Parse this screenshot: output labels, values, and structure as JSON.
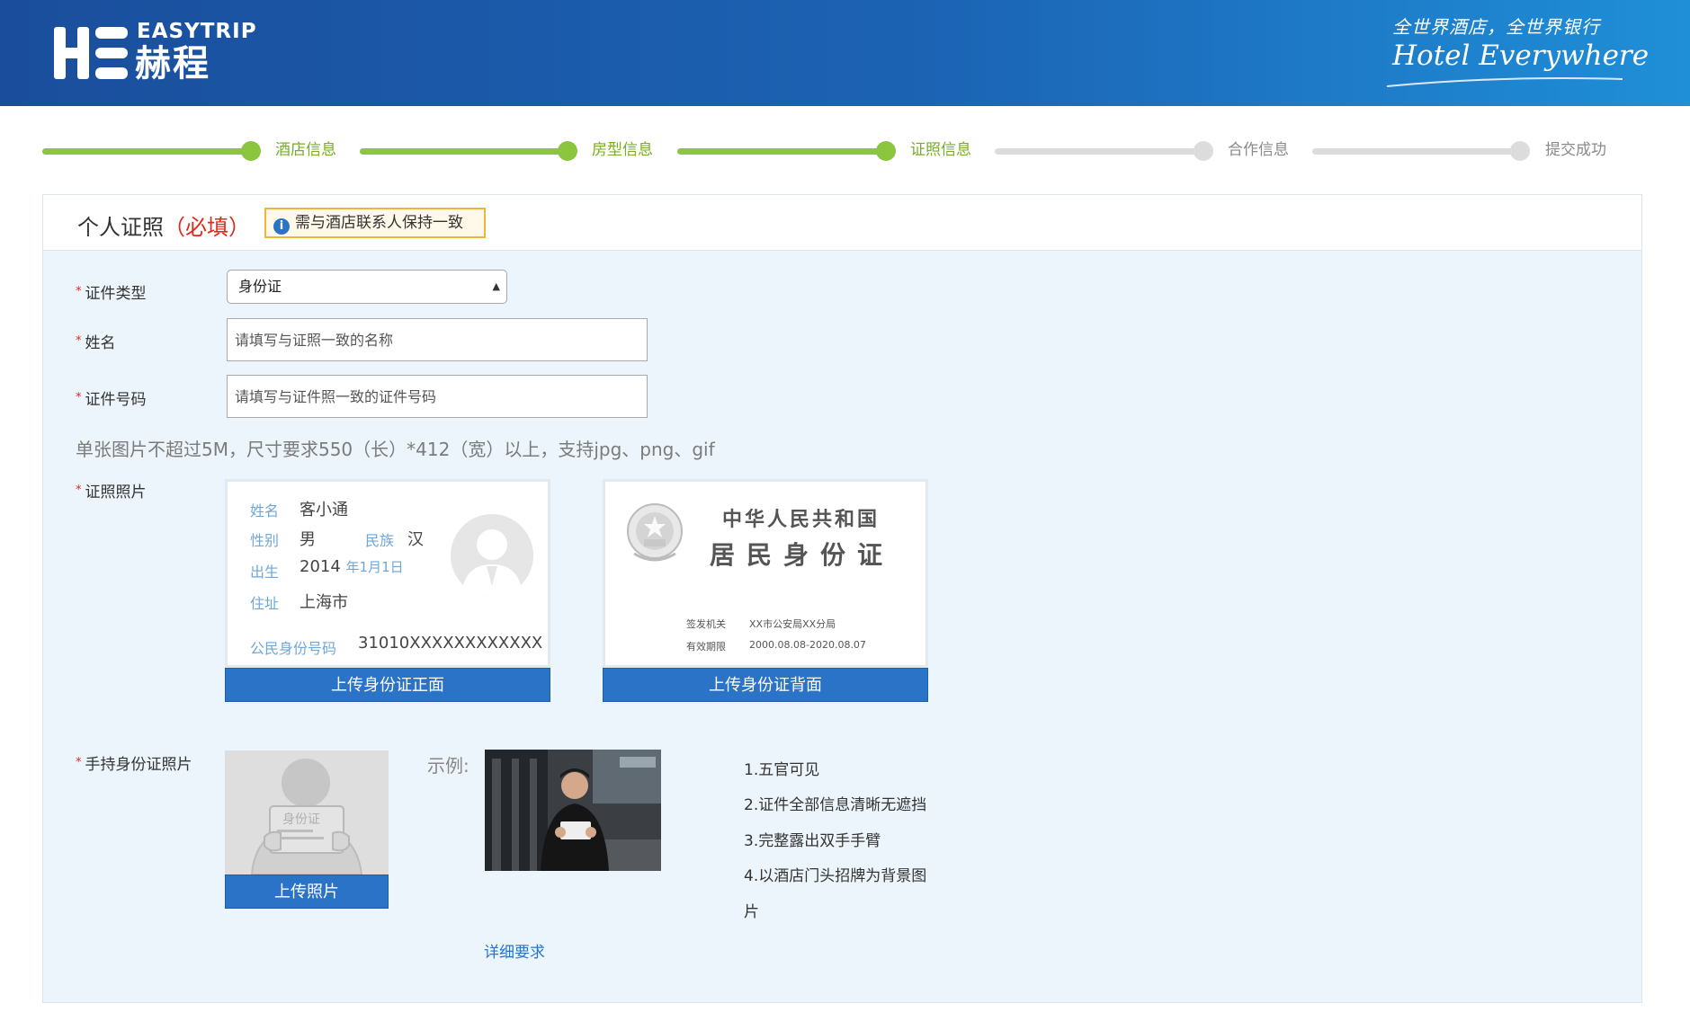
{
  "header": {
    "logo_en": "EASYTRIP",
    "logo_cn": "赫程",
    "slogan_cn": "全世界酒店，全世界银行",
    "slogan_en": "Hotel Everywhere",
    "gradient_colors": [
      "#1a4e9c",
      "#1f8fd8"
    ]
  },
  "steps": [
    {
      "label": "酒店信息",
      "state": "done"
    },
    {
      "label": "房型信息",
      "state": "done"
    },
    {
      "label": "证照信息",
      "state": "done"
    },
    {
      "label": "合作信息",
      "state": "todo"
    },
    {
      "label": "提交成功",
      "state": "todo"
    }
  ],
  "colors": {
    "step_done": "#8cc63f",
    "step_todo": "#dcdcdc",
    "primary_button": "#2a73c6",
    "required": "#e0271b",
    "panel_bg": "#edf5fc"
  },
  "panel": {
    "title": "个人证照",
    "required": "（必填）",
    "notice": "需与酒店联系人保持一致",
    "notice_icon": "info-icon"
  },
  "form": {
    "id_type_label": "证件类型",
    "id_type_value": "身份证",
    "name_label": "姓名",
    "name_placeholder": "请填写与证照一致的名称",
    "id_number_label": "证件号码",
    "id_number_placeholder": "请填写与证件照一致的证件号码",
    "hint": "单张图片不超过5M，尺寸要求550（长）*412（宽）以上，支持jpg、png、gif",
    "photo_label": "证照照片",
    "hold_label": "手持身份证照片"
  },
  "card_front": {
    "name_lbl": "姓名",
    "name_val": "客小通",
    "sex_lbl": "性别",
    "sex_val": "男",
    "ethnic_lbl": "民族",
    "ethnic_val": "汉",
    "birth_lbl": "出生",
    "birth_year": "2014",
    "birth_md": "年1月1日",
    "addr_lbl": "住址",
    "addr_val": "上海市",
    "idnum_lbl": "公民身份号码",
    "idnum_val": "31010XXXXXXXXXXXX",
    "button": "上传身份证正面"
  },
  "card_back": {
    "title1": "中华人民共和国",
    "title2": "居民身份证",
    "issuer_lbl": "签发机关",
    "issuer_val": "XX市公安局XX分局",
    "valid_lbl": "有效期限",
    "valid_val": "2000.08.08-2020.08.07",
    "button": "上传身份证背面"
  },
  "hold": {
    "placeholder_text": "身份证",
    "button": "上传照片",
    "example_label": "示例:",
    "requirements": [
      "1.五官可见",
      "2.证件全部信息清晰无遮挡",
      "3.完整露出双手手臂",
      "4.以酒店门头招牌为背景图",
      "片"
    ],
    "detail_link": "详细要求"
  }
}
